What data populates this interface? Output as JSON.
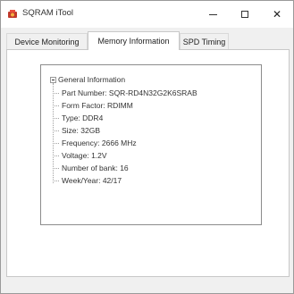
{
  "window": {
    "title": "SQRAM iTool",
    "controls": {
      "minimize": "minimize",
      "maximize": "maximize",
      "close": "✕"
    }
  },
  "tabs": [
    {
      "label": "Device Monitoring",
      "selected": false
    },
    {
      "label": "Memory Information",
      "selected": true
    },
    {
      "label": "SPD Timing",
      "selected": false
    }
  ],
  "tree": {
    "root": "General Information",
    "expanded": true,
    "items": [
      "Part Number: SQR-RD4N32G2K6SRAB",
      "Form Factor: RDIMM",
      "Type: DDR4",
      "Size: 32GB",
      "Frequency: 2666 MHz",
      "Voltage: 1.2V",
      "Number of bank: 16",
      "Week/Year: 42/17"
    ]
  },
  "icons": {
    "app": "sqram-app-icon",
    "expander": "tree-collapse-icon"
  },
  "colors": {
    "window_bg": "#f0f0f0",
    "panel_bg": "#ffffff",
    "border": "#8c8c8c"
  }
}
